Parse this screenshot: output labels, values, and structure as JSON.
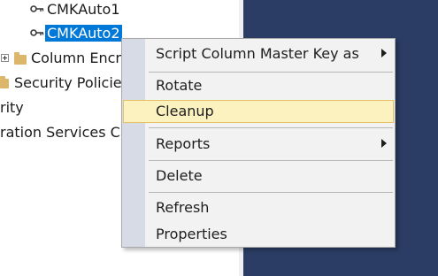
{
  "tree": {
    "items": [
      {
        "label": "CMKAuto1",
        "icon": "key-icon"
      },
      {
        "label": "CMKAuto2",
        "icon": "key-icon",
        "selected": true
      },
      {
        "label": "Column Encry",
        "icon": "folder-icon",
        "expander": "plus"
      },
      {
        "label": "Security Policies",
        "icon": "folder-icon"
      },
      {
        "label": "rity"
      },
      {
        "label": "ration Services Ca"
      }
    ]
  },
  "context_menu": {
    "items": [
      {
        "label": "Script Column Master Key as",
        "submenu": true
      },
      {
        "label": "Rotate"
      },
      {
        "label": "Cleanup",
        "highlighted": true
      },
      {
        "label": "Reports",
        "submenu": true
      },
      {
        "label": "Delete"
      },
      {
        "label": "Refresh"
      },
      {
        "label": "Properties"
      }
    ]
  },
  "colors": {
    "selection": "#0078d7",
    "menu_highlight": "#fcf2bf",
    "menu_highlight_border": "#e5c365",
    "dark_pane": "#2b3d64",
    "menu_gutter": "#d7dbe5"
  }
}
